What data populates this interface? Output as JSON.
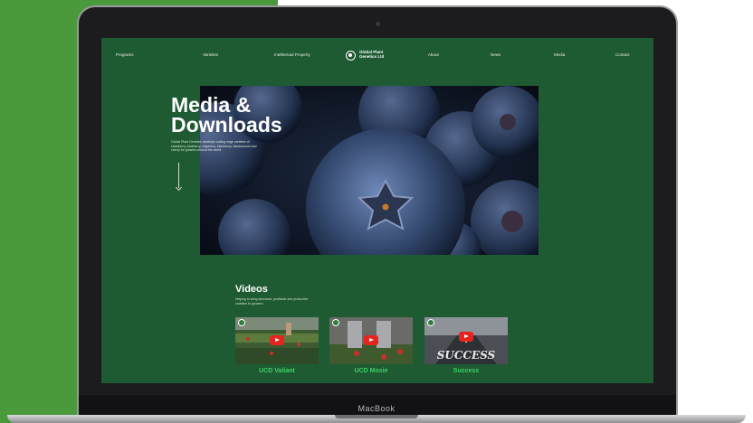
{
  "nav": {
    "items": [
      "Programs",
      "Varieties",
      "Intellectual Property",
      "About",
      "News",
      "Media",
      "Contact"
    ]
  },
  "logo": {
    "name": "Global Plant Genetics Ltd",
    "tagline": ""
  },
  "hero": {
    "title_line1": "Media &",
    "title_line2": "Downloads",
    "description": "Global Plant Genetics develops cutting edge varieties of strawberry, blueberry, raspberry, blackberry, blackcurrant and cherry for growers around the world."
  },
  "videos": {
    "title": "Videos",
    "description": "Helping to bring abundant, profitable and productive varieties to growers.",
    "items": [
      {
        "title": "UCD Valiant",
        "subtitle": ""
      },
      {
        "title": "UCD Moxie",
        "subtitle": ""
      },
      {
        "title": "Success",
        "subtitle": ""
      }
    ],
    "success_overlay": "SUCCESS"
  },
  "device": {
    "label": "MacBook"
  },
  "colors": {
    "screen_bg": "#1e5a32",
    "page_accent": "#4a9a3c",
    "video_title": "#3ed16a",
    "play_button": "#e5241f"
  }
}
